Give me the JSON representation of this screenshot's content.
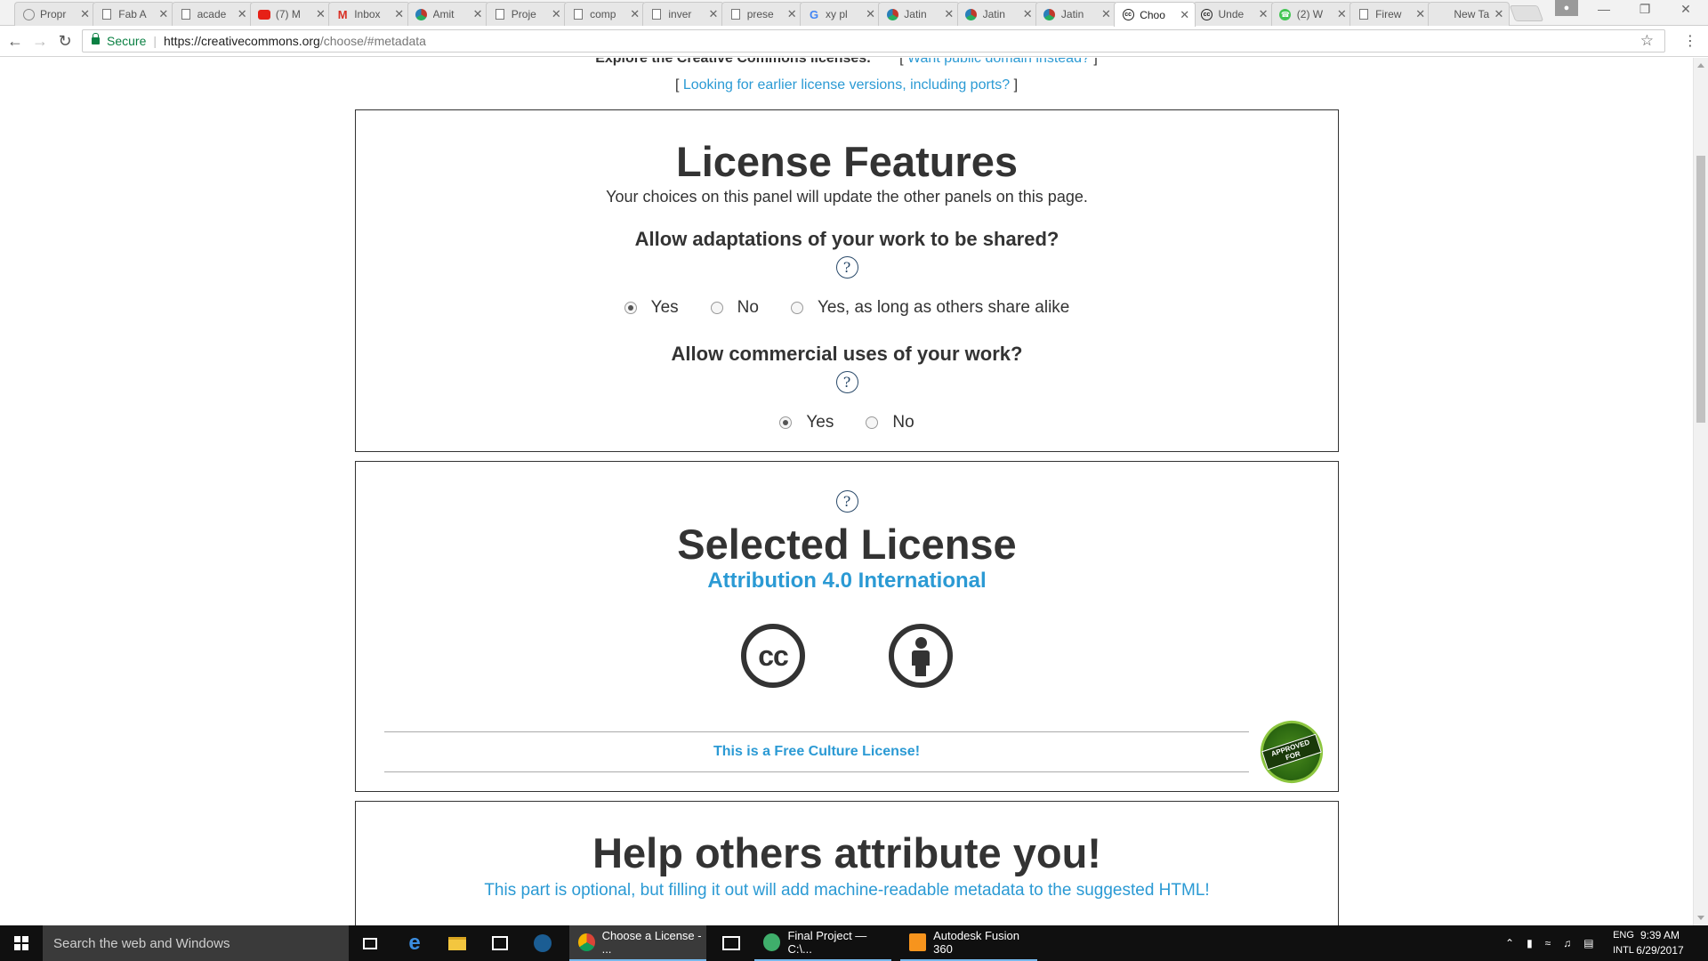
{
  "browser": {
    "tabs": [
      {
        "title": "Propr",
        "favicon": "ph-icon"
      },
      {
        "title": "Fab A",
        "favicon": "doc-icon"
      },
      {
        "title": "acade",
        "favicon": "doc-icon"
      },
      {
        "title": "(7) M",
        "favicon": "youtube-icon"
      },
      {
        "title": "Inbox",
        "favicon": "gmail-icon"
      },
      {
        "title": "Amit",
        "favicon": "github-icon"
      },
      {
        "title": "Proje",
        "favicon": "doc-icon"
      },
      {
        "title": "comp",
        "favicon": "doc-icon"
      },
      {
        "title": "inver",
        "favicon": "doc-icon"
      },
      {
        "title": "prese",
        "favicon": "doc-icon"
      },
      {
        "title": "xy pl",
        "favicon": "google-icon"
      },
      {
        "title": "Jatin",
        "favicon": "github-icon"
      },
      {
        "title": "Jatin",
        "favicon": "github-icon"
      },
      {
        "title": "Jatin",
        "favicon": "github-icon"
      },
      {
        "title": "Choo",
        "favicon": "cc-icon",
        "active": true
      },
      {
        "title": "Unde",
        "favicon": "cc-icon"
      },
      {
        "title": "(2) W",
        "favicon": "whatsapp-icon"
      },
      {
        "title": "Firew",
        "favicon": "doc-icon"
      },
      {
        "title": "New Tab",
        "favicon": "none"
      }
    ],
    "address": {
      "secure_label": "Secure",
      "url_host": "https://creativecommons.org",
      "url_path": "/choose/#metadata"
    }
  },
  "page": {
    "explore_text": "Explore the Creative Commons licenses.",
    "public_domain_link": "Want public domain instead?",
    "earlier_versions_link": "Looking for earlier license versions, including ports?",
    "bracket_open": "[",
    "bracket_close": "]",
    "features": {
      "title": "License Features",
      "subtitle": "Your choices on this panel will update the other panels on this page.",
      "q1": "Allow adaptations of your work to be shared?",
      "q1_options": [
        "Yes",
        "No",
        "Yes, as long as others share alike"
      ],
      "q1_selected": 0,
      "q2": "Allow commercial uses of your work?",
      "q2_options": [
        "Yes",
        "No"
      ],
      "q2_selected": 0,
      "help_glyph": "?"
    },
    "selected": {
      "title": "Selected License",
      "license_name": "Attribution 4.0 International",
      "cc_glyph": "cc",
      "free_culture": "This is a Free Culture License!",
      "seal_text": "APPROVED FOR"
    },
    "attribute": {
      "title": "Help others attribute you!",
      "subtitle": "This part is optional, but filling it out will add machine-readable metadata to the suggested HTML!"
    }
  },
  "taskbar": {
    "search_placeholder": "Search the web and Windows",
    "apps": [
      {
        "label": "Choose a License - ..."
      },
      {
        "label": "Final Project — C:\\..."
      },
      {
        "label": "Autodesk Fusion 360"
      }
    ],
    "lang_top": "ENG",
    "lang_bottom": "INTL",
    "time": "9:39 AM",
    "date": "6/29/2017"
  },
  "colors": {
    "link_blue": "#2b9ad4",
    "secure_green": "#0b8043",
    "taskbar_bg": "#101010"
  }
}
